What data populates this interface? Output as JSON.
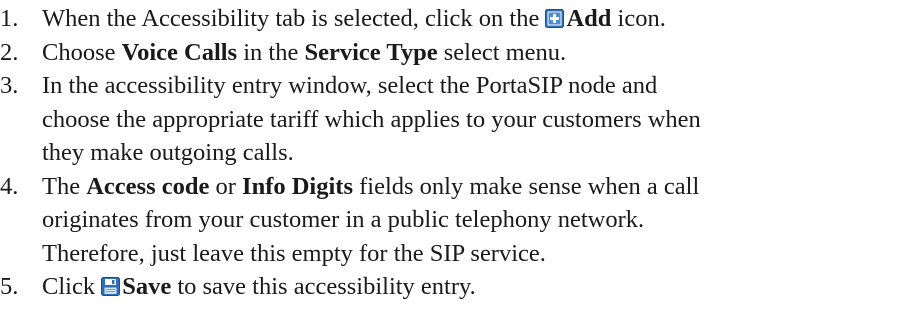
{
  "steps": [
    {
      "num": "1.",
      "p1": "When the Accessibility tab is selected, click on the ",
      "icon": "add-icon",
      "b1": "Add",
      "p2": " icon."
    },
    {
      "num": "2.",
      "p1": "Choose ",
      "b1": "Voice Calls",
      "p2": " in the ",
      "b2": "Service Type",
      "p3": " select menu."
    },
    {
      "num": "3.",
      "l1": "In the accessibility entry window, select the PortaSIP node and",
      "l2": "choose the appropriate tariff which applies to your customers when",
      "l3": "they make outgoing calls."
    },
    {
      "num": "4.",
      "p1": "The ",
      "b1": "Access code",
      "p2": " or ",
      "b2": "Info Digits",
      "p3": " fields only make sense when a call",
      "l2": "originates from your customer in a public telephony network.",
      "l3": "Therefore, just leave this empty for the SIP service."
    },
    {
      "num": "5.",
      "p1": "Click ",
      "icon": "save-icon",
      "b1": "Save",
      "p2": " to save this accessibility entry."
    }
  ],
  "colors": {
    "text": "#1a1a1a",
    "icon_blue": "#2f6fb8",
    "icon_blue_dark": "#1d4f8f"
  }
}
